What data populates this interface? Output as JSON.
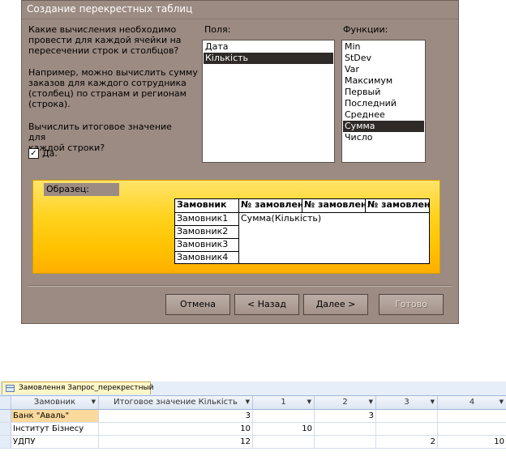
{
  "dialog": {
    "title": "Создание перекрестных таблиц",
    "question_lines": [
      "Какие вычисления необходимо",
      "провести для каждой ячейки на",
      "пересечении строк и столбцов?"
    ],
    "example_lines": [
      "Например, можно вычислить сумму",
      "заказов для каждого сотрудника",
      "(столбец) по странам и регионам",
      "(строка)."
    ],
    "total_lines": [
      "Вычислить итоговое значение для",
      "каждой строки?"
    ],
    "checkbox_label": "Да.",
    "checkbox_checked": true,
    "fields_label": "Поля:",
    "fields": [
      "Дата",
      "Кількість"
    ],
    "fields_selected": "Кількість",
    "functions_label": "Функции:",
    "functions": [
      "Min",
      "StDev",
      "Var",
      "Максимум",
      "Первый",
      "Последний",
      "Среднее",
      "Сумма",
      "Число"
    ],
    "functions_selected": "Сумма",
    "sample_label": "Образец:",
    "sample_headers": [
      "Замовник",
      "№ замовлен",
      "№ замовлен",
      "№ замовлен"
    ],
    "sample_rows": [
      "Замовник1",
      "Замовник2",
      "Замовник3",
      "Замовник4"
    ],
    "sample_value": "Сумма(Кількість)",
    "buttons": {
      "cancel": "Отмена",
      "back": "< Назад",
      "next": "Далее >",
      "finish": "Готово"
    }
  },
  "datasheet": {
    "tab_label": "Замовлення Запрос_перекрестный",
    "columns": [
      "Замовник",
      "Итоговое значение Кількість",
      "1",
      "2",
      "3",
      "4"
    ],
    "rows": [
      {
        "name": "Банк \"Аваль\"",
        "total": "3",
        "c1": "",
        "c2": "3",
        "c3": "",
        "c4": ""
      },
      {
        "name": "Інститут Бізнесу",
        "total": "10",
        "c1": "10",
        "c2": "",
        "c3": "",
        "c4": ""
      },
      {
        "name": "УДПУ",
        "total": "12",
        "c1": "",
        "c2": "",
        "c3": "2",
        "c4": "10"
      }
    ]
  },
  "colors": {
    "dialog_bg": "#9c8b82",
    "selection": "#2f2a28",
    "sample_gradient_top": "#ffe46a",
    "sample_gradient_bottom": "#ffae00",
    "current_cell": "#fbd89c"
  }
}
